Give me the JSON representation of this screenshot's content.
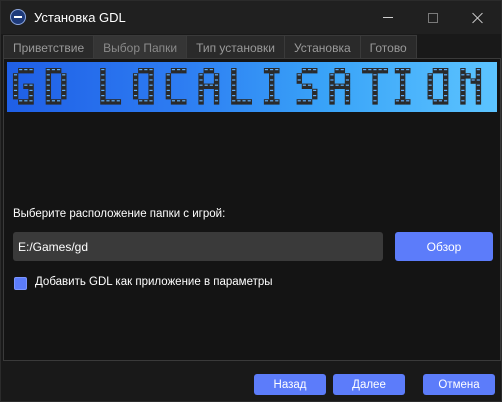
{
  "window": {
    "title": "Установка GDL",
    "app_icon": "gdl-app-icon"
  },
  "tabs": [
    {
      "label": "Приветствие",
      "active": false
    },
    {
      "label": "Выбор Папки",
      "active": true
    },
    {
      "label": "Тип установки",
      "active": false
    },
    {
      "label": "Установка",
      "active": false
    },
    {
      "label": "Готово",
      "active": false
    }
  ],
  "banner": {
    "text": "GD LOCALISATION",
    "colors": {
      "from": "#1f5fe6",
      "to": "#5cc4ff",
      "letters": "#2a2a2a",
      "letter_highlight": "#ffffff"
    }
  },
  "folder": {
    "label": "Выберите расположение папки с игрой:",
    "path_value": "E:/Games/gd",
    "browse_label": "Обзор"
  },
  "options": {
    "add_as_app_label": "Добавить GDL как приложение в параметры",
    "add_as_app_checked": true
  },
  "footer": {
    "back_label": "Назад",
    "next_label": "Далее",
    "cancel_label": "Отмена"
  },
  "colors": {
    "accent": "#5c7cfa",
    "background": "#191919",
    "input_bg": "#3a3a3a"
  }
}
